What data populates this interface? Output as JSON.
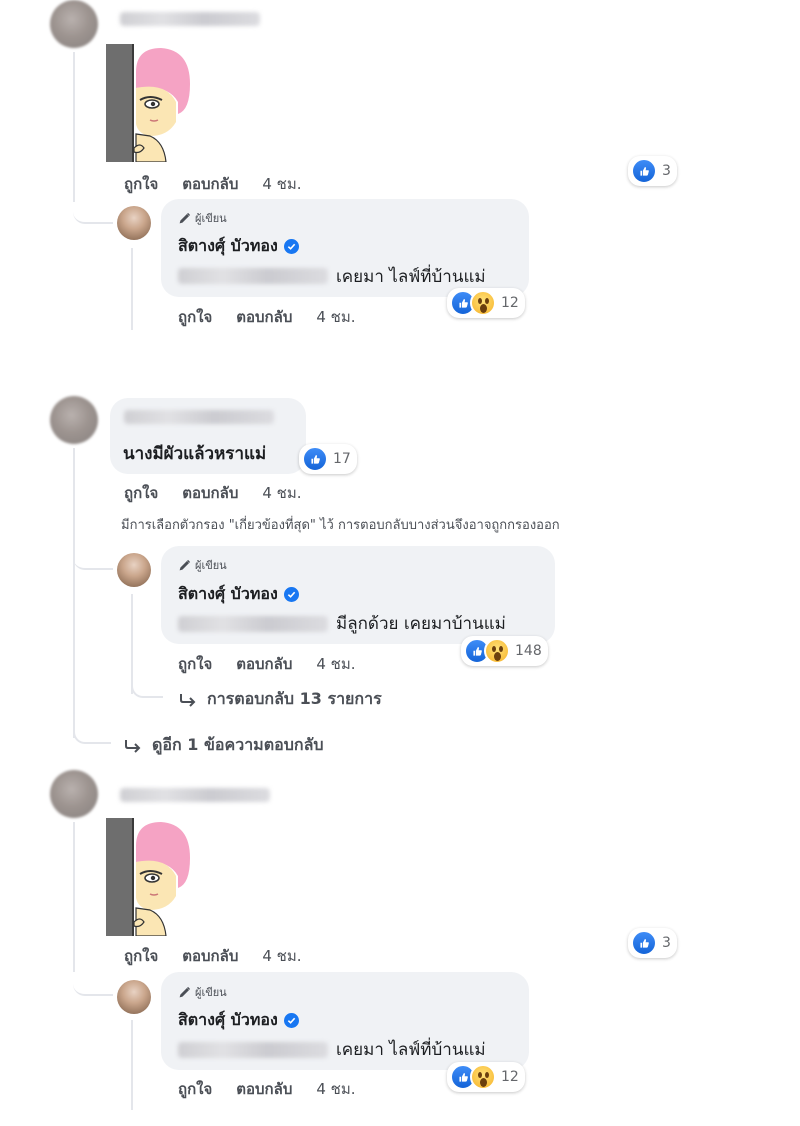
{
  "action_labels": {
    "like": "ถูกใจ",
    "reply": "ตอบกลับ"
  },
  "author_badge": "ผู้เขียน",
  "colors": {
    "brand_blue": "#1877f2",
    "bubble_bg": "#f0f2f5",
    "meta_text": "#4b4f56"
  },
  "comments": [
    {
      "kind": "sticker",
      "time": "4 ชม.",
      "reaction_count": "3",
      "reply": {
        "author": "สิตางศุ์ บัวทอง",
        "text": "เคยมา ไลฟ์ที่บ้านแม่",
        "time": "4 ชม.",
        "reaction_count": "12"
      }
    },
    {
      "kind": "text",
      "text": "นางมีผัวแล้วหราแม่",
      "time": "4 ชม.",
      "reaction_count": "17",
      "filter_note": "มีการเลือกตัวกรอง \"เกี่ยวข้องที่สุด\" ไว้ การตอบกลับบางส่วนจึงอาจถูกกรองออก",
      "reply": {
        "author": "สิตางศุ์ บัวทอง",
        "text": "มีลูกด้วย เคยมาบ้านแม่",
        "time": "4 ชม.",
        "reaction_count": "148"
      },
      "more_replies": "การตอบกลับ 13 รายการ",
      "see_more": "ดูอีก 1 ข้อความตอบกลับ"
    },
    {
      "kind": "sticker",
      "time": "4 ชม.",
      "reaction_count": "3",
      "reply": {
        "author": "สิตางศุ์ บัวทอง",
        "text": "เคยมา ไลฟ์ที่บ้านแม่",
        "time": "4 ชม.",
        "reaction_count": "12"
      }
    }
  ],
  "icons": [
    "pencil-icon",
    "verified-badge-icon",
    "like-reaction-icon",
    "wow-reaction-icon",
    "reply-arrow-icon",
    "sticker-peeking-girl"
  ]
}
